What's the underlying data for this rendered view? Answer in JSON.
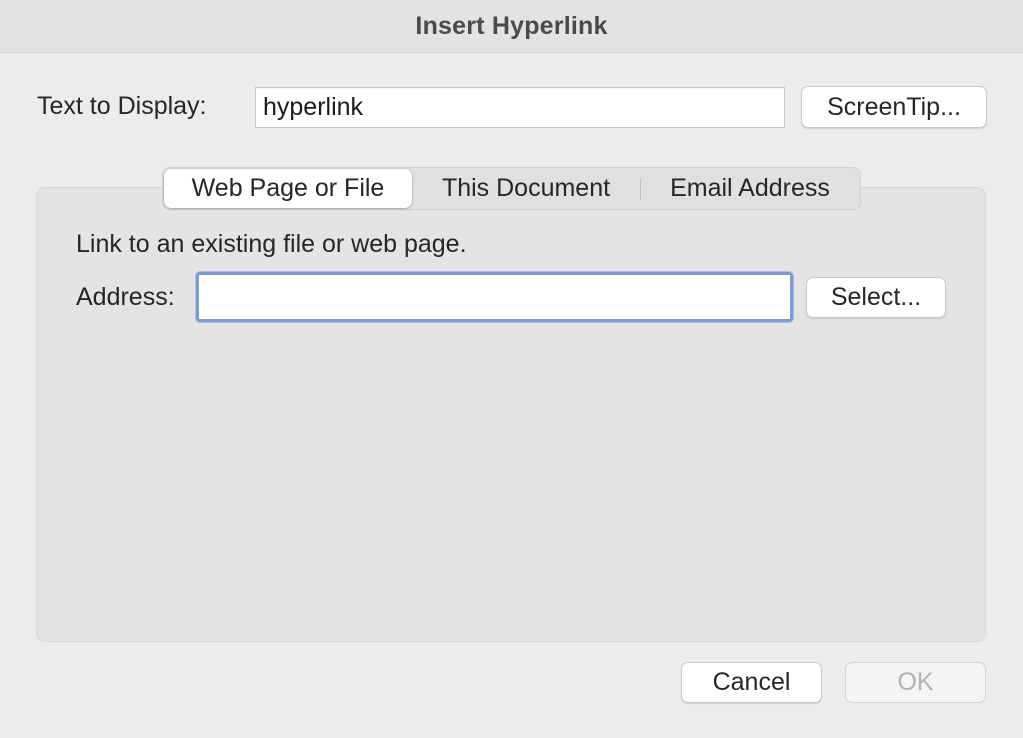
{
  "window": {
    "title": "Insert Hyperlink"
  },
  "display": {
    "label": "Text to Display:",
    "value": "hyperlink",
    "screentip_button": "ScreenTip..."
  },
  "tabs": [
    {
      "label": "Web Page or File",
      "selected": true
    },
    {
      "label": "This Document",
      "selected": false
    },
    {
      "label": "Email Address",
      "selected": false
    }
  ],
  "panel": {
    "description": "Link to an existing file or web page.",
    "address_label": "Address:",
    "address_value": "",
    "select_button": "Select..."
  },
  "footer": {
    "cancel_button": "Cancel",
    "ok_button": "OK",
    "ok_enabled": false
  },
  "colors": {
    "focus_ring": "#7d9bd0",
    "window_bg": "#ececec",
    "panel_bg": "#e4e4e4"
  }
}
